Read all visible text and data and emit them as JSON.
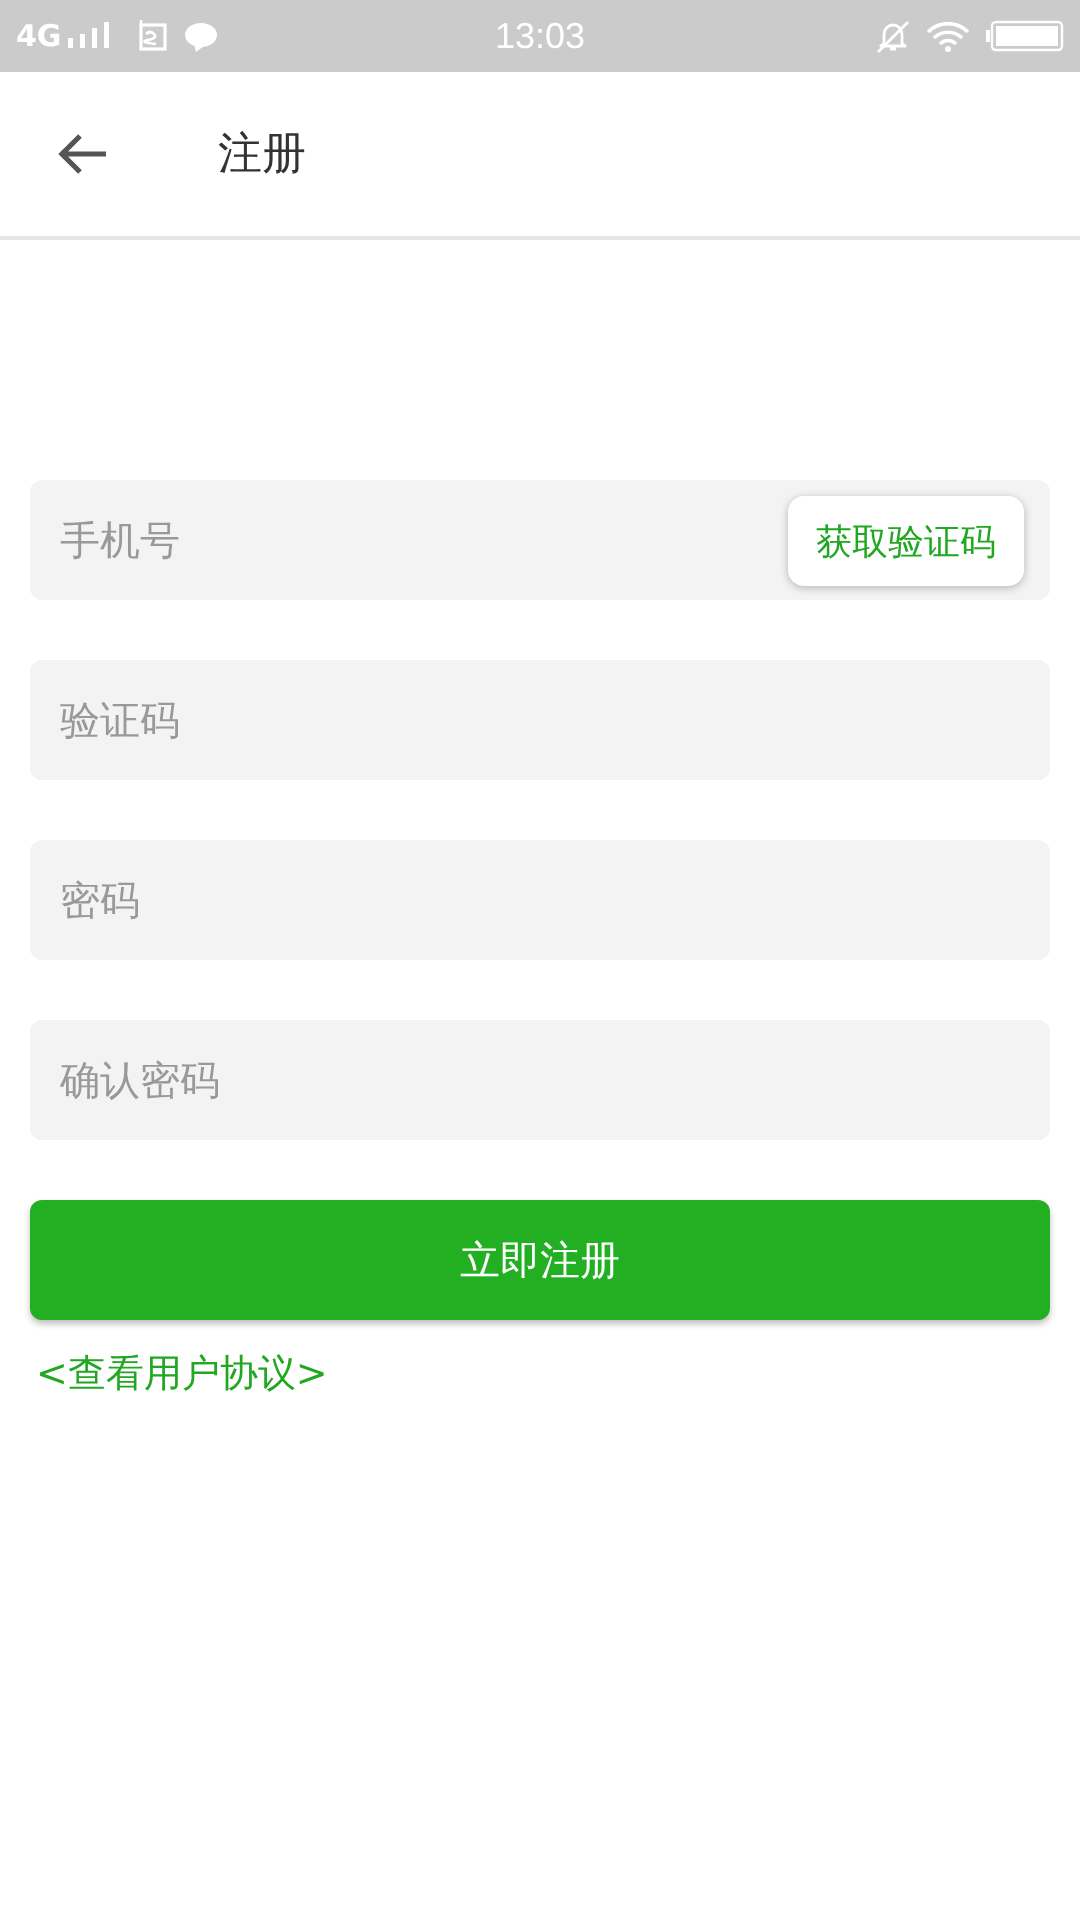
{
  "status_bar": {
    "network": "4G",
    "time": "13:03"
  },
  "header": {
    "title": "注册"
  },
  "fields": [
    {
      "placeholder": "手机号",
      "kind": "with_button",
      "button": "获取验证码"
    },
    {
      "placeholder": "验证码",
      "kind": "plain"
    },
    {
      "placeholder": "密码",
      "kind": "plain"
    },
    {
      "placeholder": "确认密码",
      "kind": "plain"
    }
  ],
  "submit_button": "立即注册",
  "agreement_link": "<查看用户协议>"
}
